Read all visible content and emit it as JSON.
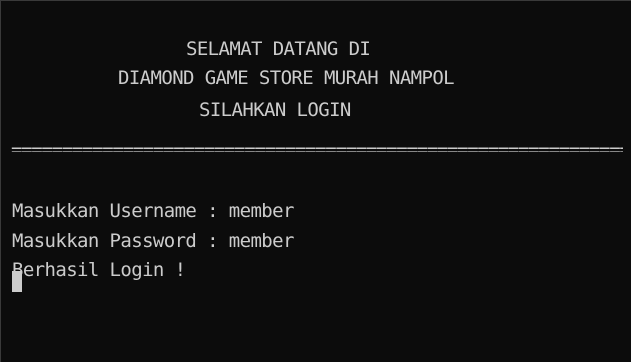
{
  "console": {
    "header_line1": "SELAMAT DATANG DI",
    "header_line2": "DIAMOND GAME STORE MURAH NAMPOL",
    "header_line3": "SILAHKAN LOGIN",
    "separator": "================================================================",
    "username_prompt": "Masukkan Username : member",
    "password_prompt": "Masukkan Password : member",
    "login_status": "Berhasil Login !"
  }
}
